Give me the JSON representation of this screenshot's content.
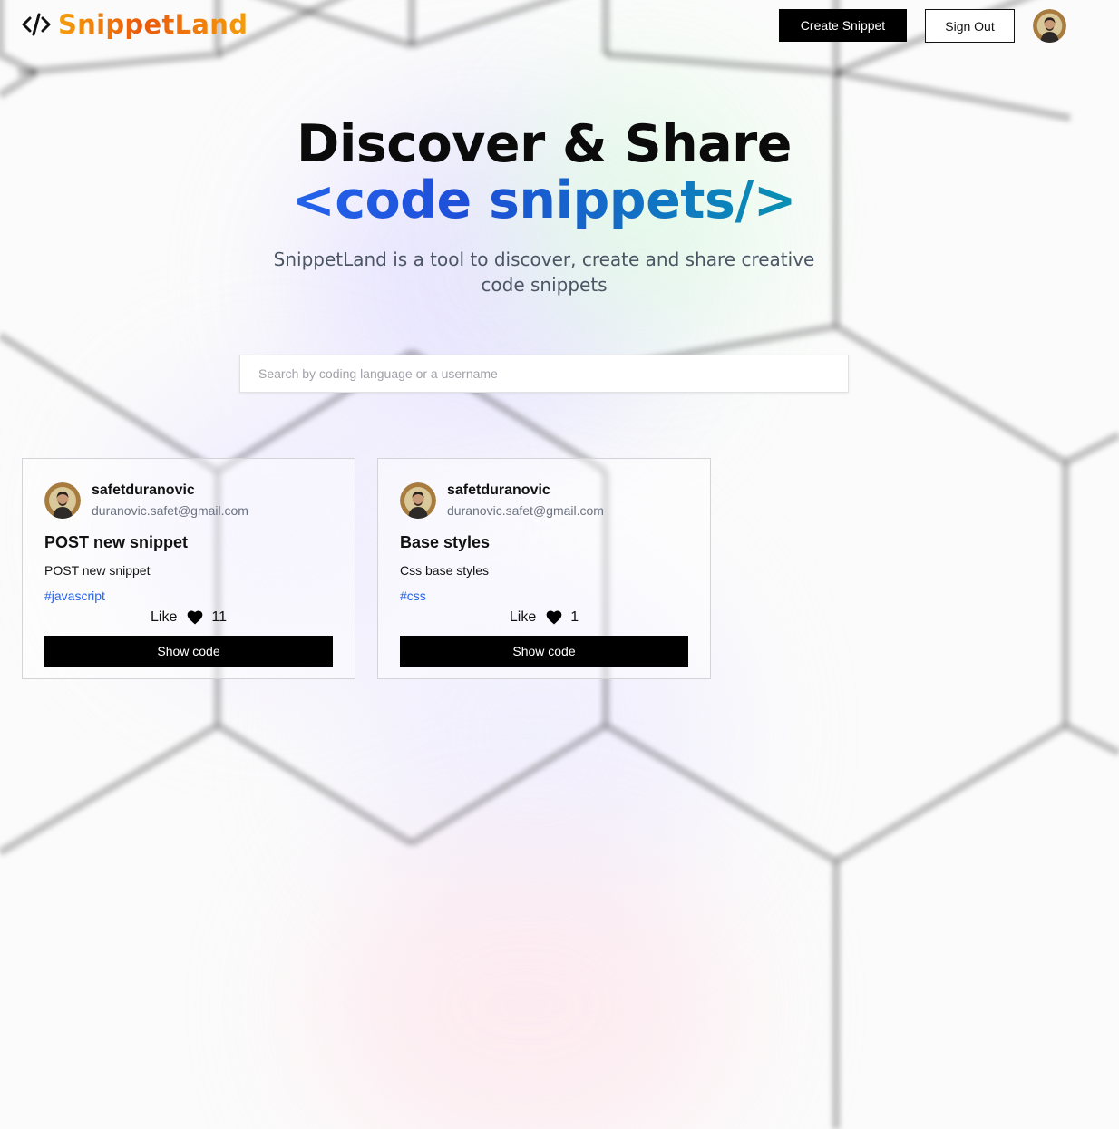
{
  "brand": {
    "name": "SnippetLand",
    "accent": "#ea580c"
  },
  "nav": {
    "create_label": "Create Snippet",
    "signout_label": "Sign Out",
    "avatar_alt": "user avatar"
  },
  "hero": {
    "title_line1": "Discover & Share",
    "title_line2": "<code snippets/>",
    "subtitle": "SnippetLand is a tool to discover, create and share creative code snippets"
  },
  "search": {
    "placeholder": "Search by coding language or a username",
    "value": ""
  },
  "snippets": [
    {
      "username": "safetduranovic",
      "email": "duranovic.safet@gmail.com",
      "title": "POST new snippet",
      "description": "POST new snippet",
      "tag": "#javascript",
      "like_label": "Like",
      "likes": "11",
      "button_label": "Show code"
    },
    {
      "username": "safetduranovic",
      "email": "duranovic.safet@gmail.com",
      "title": "Base styles",
      "description": "Css base styles",
      "tag": "#css",
      "like_label": "Like",
      "likes": "1",
      "button_label": "Show code"
    }
  ],
  "colors": {
    "button_bg": "#000000",
    "tag": "#2563eb",
    "gradient_start": "#2563eb",
    "gradient_end": "#0891b2"
  }
}
